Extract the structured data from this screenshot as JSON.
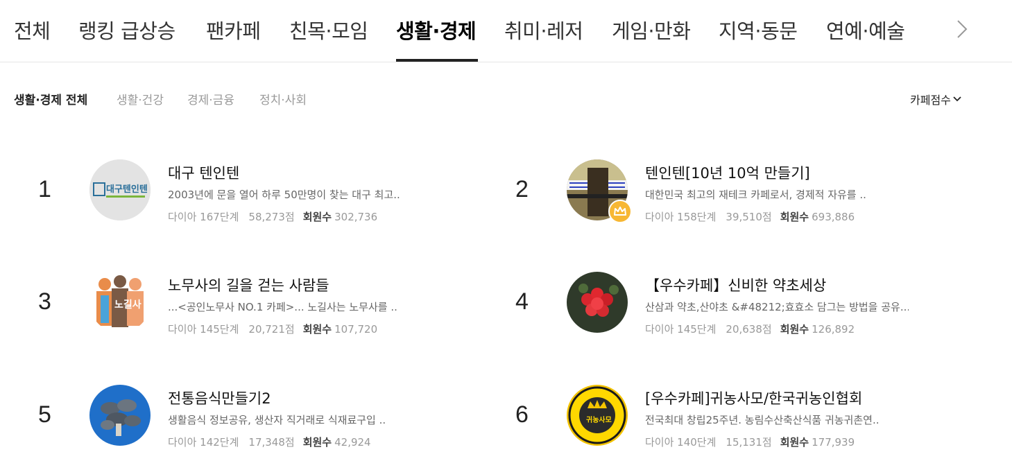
{
  "top_tabs": [
    {
      "label": "전체"
    },
    {
      "label": "랭킹 급상승"
    },
    {
      "label": "팬카페"
    },
    {
      "label": "친목·모임"
    },
    {
      "label": "생활·경제"
    },
    {
      "label": "취미·레저"
    },
    {
      "label": "게임·만화"
    },
    {
      "label": "지역·동문"
    },
    {
      "label": "연예·예술"
    }
  ],
  "active_top_tab": "생활·경제",
  "sub_tabs": [
    {
      "label": "생활·경제 전체"
    },
    {
      "label": "생활·건강"
    },
    {
      "label": "경제·금융"
    },
    {
      "label": "정치·사회"
    }
  ],
  "sort": {
    "label": "카페점수"
  },
  "cafes": [
    {
      "rank": "1",
      "name": "대구 텐인텐",
      "desc": "2003년에 문을 열어 하루 50만명이 찾는 대구 최고..",
      "grade": "다이아 167단계",
      "score": "58,273점",
      "members_label": "회원수",
      "members": "302,736",
      "thumb_text": "대구텐인텐"
    },
    {
      "rank": "2",
      "name": "텐인텐[10년 10억 만들기]",
      "desc": "대한민국 최고의 재테크 카페로서, 경제적 자유를 ..",
      "grade": "다이아 158단계",
      "score": "39,510점",
      "members_label": "회원수",
      "members": "693,886",
      "thumb_text": ""
    },
    {
      "rank": "3",
      "name": "노무사의 길을 걷는 사람들",
      "desc": "...<공인노무사 NO.1 카페>... 노길사는 노무사를 ..",
      "grade": "다이아 145단계",
      "score": "20,721점",
      "members_label": "회원수",
      "members": "107,720",
      "thumb_text": "노길사"
    },
    {
      "rank": "4",
      "name": "【우수카페】신비한 약초세상",
      "desc": "산삼과 약초,산야초 &#48212;효효소 담그는 방법을 공유...",
      "grade": "다이아 145단계",
      "score": "20,638점",
      "members_label": "회원수",
      "members": "126,892",
      "thumb_text": ""
    },
    {
      "rank": "5",
      "name": "전통음식만들기2",
      "desc": "생활음식 정보공유, 생산자 직거래로 식재료구입 ..",
      "grade": "다이아 142단계",
      "score": "17,348점",
      "members_label": "회원수",
      "members": "42,924",
      "thumb_text": ""
    },
    {
      "rank": "6",
      "name": "[우수카페]귀농사모/한국귀농인협회",
      "desc": "전국최대 창립25주년. 농림수산축산식품 귀농귀촌연..",
      "grade": "다이아 140단계",
      "score": "15,131점",
      "members_label": "회원수",
      "members": "177,939",
      "thumb_text": "귀농사모"
    }
  ],
  "colors": {
    "accent": "#222222",
    "crown": "#f7b733",
    "muted": "#999999"
  }
}
